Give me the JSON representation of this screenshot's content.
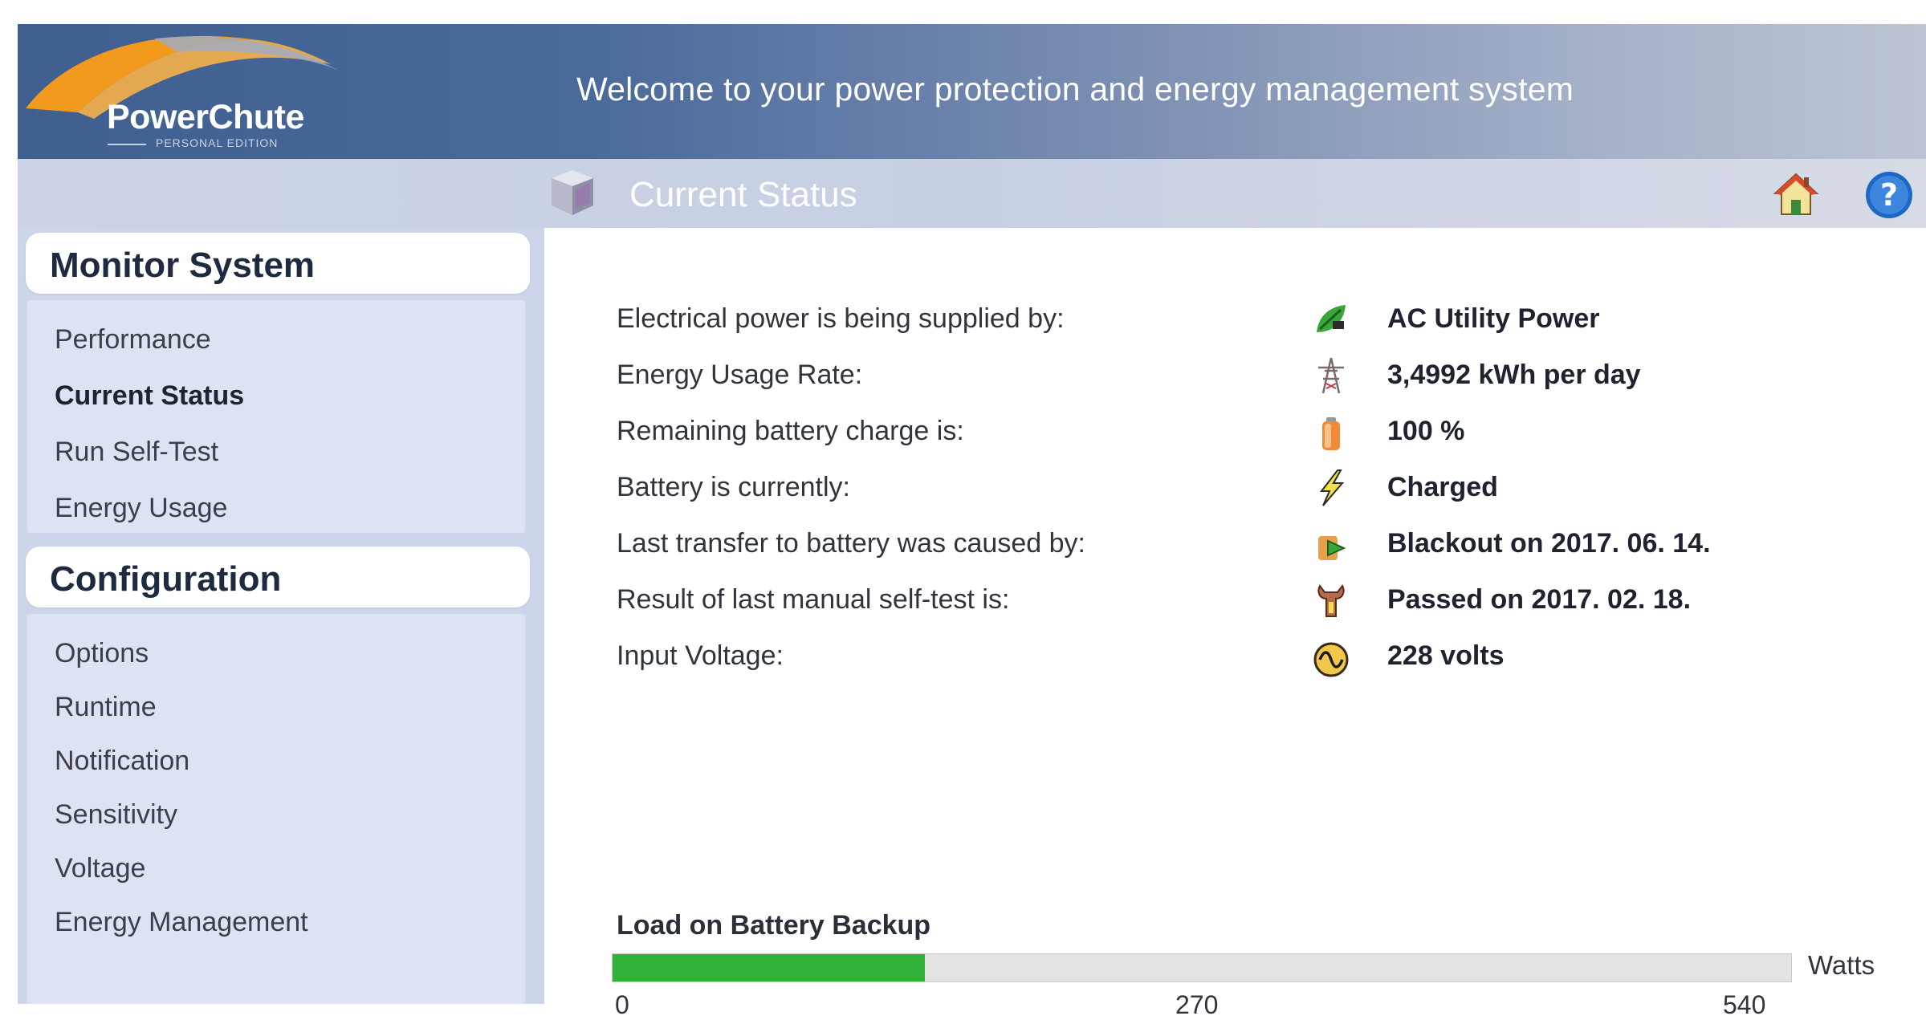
{
  "header": {
    "logo_text": "PowerChute",
    "logo_subtext": "PERSONAL EDITION",
    "welcome": "Welcome to your power protection and energy management system"
  },
  "subheader": {
    "title": "Current Status",
    "icons": [
      "cube-icon",
      "home-icon",
      "help-icon"
    ]
  },
  "sidebar": {
    "monitor": {
      "title": "Monitor System",
      "items": [
        {
          "label": "Performance",
          "active": false
        },
        {
          "label": "Current Status",
          "active": true
        },
        {
          "label": "Run Self-Test",
          "active": false
        },
        {
          "label": "Energy Usage",
          "active": false
        }
      ]
    },
    "configuration": {
      "title": "Configuration",
      "items": [
        {
          "label": "Options"
        },
        {
          "label": "Runtime"
        },
        {
          "label": "Notification"
        },
        {
          "label": "Sensitivity"
        },
        {
          "label": "Voltage"
        },
        {
          "label": "Energy Management"
        }
      ]
    }
  },
  "status": [
    {
      "label": "Electrical power is being supplied by:",
      "value": "AC Utility Power",
      "icon": "plug-leaf-icon"
    },
    {
      "label": "Energy Usage Rate:",
      "value": "3,4992 kWh per day",
      "icon": "power-tower-icon"
    },
    {
      "label": "Remaining battery charge is:",
      "value": "100 %",
      "icon": "battery-icon"
    },
    {
      "label": "Battery is currently:",
      "value": "Charged",
      "icon": "lightning-icon"
    },
    {
      "label": "Last transfer to battery was caused by:",
      "value": "Blackout on 2017. 06. 14.",
      "icon": "transfer-icon"
    },
    {
      "label": "Result of last manual self-test is:",
      "value": "Passed on 2017. 02. 18.",
      "icon": "wrench-icon"
    },
    {
      "label": "Input Voltage:",
      "value": "228 volts",
      "icon": "sine-wave-icon"
    }
  ],
  "load": {
    "title": "Load on Battery Backup",
    "unit": "Watts",
    "ticks": [
      "0",
      "270",
      "540"
    ],
    "value_fraction": 0.265,
    "fill_color": "#2fb13a"
  },
  "colors": {
    "header_dark": "#3f5f90",
    "sidebar_bg": "#cdd5ea",
    "logo_orange": "#f29a1e"
  }
}
